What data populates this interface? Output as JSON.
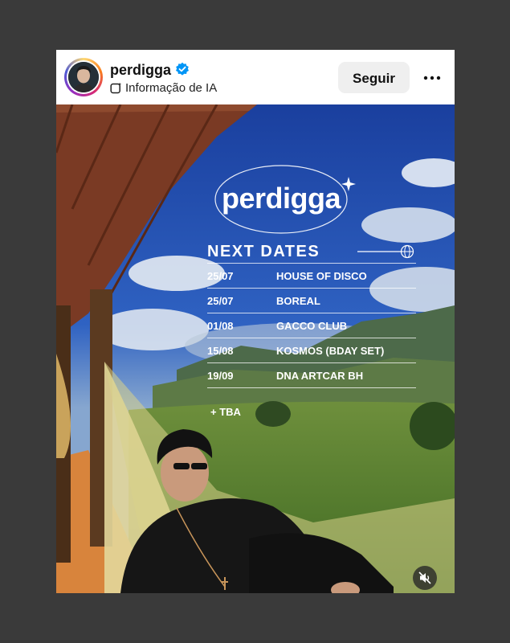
{
  "post": {
    "username": "perdigga",
    "ai_label": "Informação de IA",
    "follow_label": "Seguir"
  },
  "poster": {
    "brand": "perdigga",
    "heading": "NEXT DATES",
    "dates": [
      {
        "date": "25/07",
        "venue": "HOUSE OF DISCO"
      },
      {
        "date": "25/07",
        "venue": "BOREAL"
      },
      {
        "date": "01/08",
        "venue": "GACCO CLUB"
      },
      {
        "date": "15/08",
        "venue": "KOSMOS (BDAY SET)"
      },
      {
        "date": "19/09",
        "venue": "DNA ARTCAR BH"
      }
    ],
    "tba": "+ TBA"
  },
  "icons": {
    "verified": "verified-badge-icon",
    "ai": "ai-info-icon",
    "more": "more-options-icon",
    "mute": "muted-speaker-icon",
    "globe": "globe-icon",
    "sparkle": "sparkle-icon"
  },
  "colors": {
    "verified_blue": "#0095f6",
    "follow_bg": "#efefef",
    "page_bg": "#3a3a3a"
  }
}
